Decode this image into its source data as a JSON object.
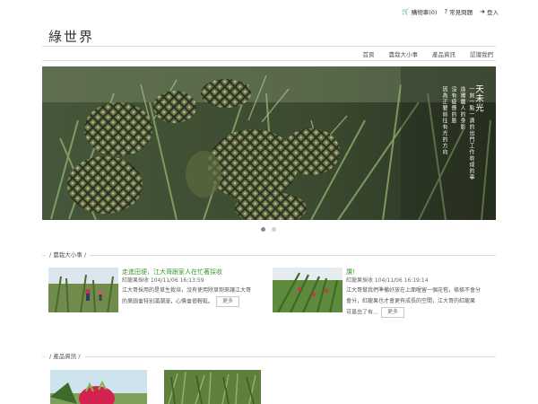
{
  "topbar": {
    "cart": "購物車(0)",
    "faq": "常見問題",
    "login": "登入"
  },
  "site": {
    "logo": "綠世界"
  },
  "nav": [
    "首頁",
    "農栽大小事",
    "產品資訊",
    "認識我們"
  ],
  "hero": {
    "title": "天未光",
    "poem": [
      "一刻一點一滴的出門工作收成的事",
      "造陽農人的身影",
      "沒有疲憊的臉",
      "因為正要前往有光的方向"
    ]
  },
  "carousel": {
    "count": 2,
    "active": 0
  },
  "sections": {
    "news": "農栽大小事",
    "products": "產品資訊"
  },
  "news": [
    {
      "title": "走進田埂，江大哥跟家人在忙著採收",
      "meta": "紅龍果採收 104/11/06 16:13:59",
      "excerpt1": "江大哥採用的是草生栽培，沒有使用除草劑來讓江大哥",
      "excerpt2": "的果園會特別滿潮溼，心情會很輕鬆。",
      "more": "更多"
    },
    {
      "title": "讚！",
      "meta": "紅龍果採收 104/11/06 16:19:14",
      "excerpt1": "江大哥幫我們準備好放在上面喔留一個花苞，條條不會分",
      "excerpt2": "會分，紅龍果也才會更有成長的空間，江大哥的紅龍果",
      "excerpt3": "可是出了有…",
      "more": "更多"
    }
  ],
  "colors": {
    "accent_green": "#3a9a2f",
    "rule": "#dcdcdc"
  }
}
